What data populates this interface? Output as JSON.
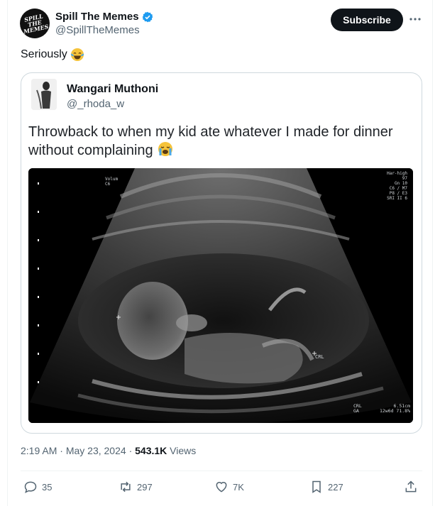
{
  "author": {
    "display_name": "Spill The Memes",
    "handle": "@SpillTheMemes",
    "avatar_text": "SPILL\nTHE\nMEMES",
    "verified_color": "#1d9bf0"
  },
  "header": {
    "subscribe_label": "Subscribe",
    "more_icon": "more-horizontal-icon"
  },
  "tweet": {
    "text": "Seriously",
    "emoji": "face-with-tears-of-joy"
  },
  "quote": {
    "display_name": "Wangari Muthoni",
    "handle": "@_rhoda_w",
    "text": "Throwback to when my kid ate whatever I made for dinner without complaining",
    "emoji": "loudly-crying-face",
    "image": {
      "top_right_lines": [
        "Har-high",
        "97",
        "Gn 10",
        "C6 / M7",
        "P8 / E3",
        "SRI II 6"
      ],
      "top_left_lines": [
        "Volum",
        "C6"
      ],
      "crl_marker": "CRL",
      "bottom_right": {
        "row1_label": "CRL",
        "row1_value": "6.51cm",
        "row2_label": "GA",
        "row2_value": "12w6d 71.8%"
      }
    }
  },
  "meta": {
    "time": "2:19 AM",
    "date": "May 23, 2024",
    "views_count": "543.1K",
    "views_label": "Views"
  },
  "actions": {
    "replies": "35",
    "reposts": "297",
    "likes": "7K",
    "bookmarks": "227"
  }
}
